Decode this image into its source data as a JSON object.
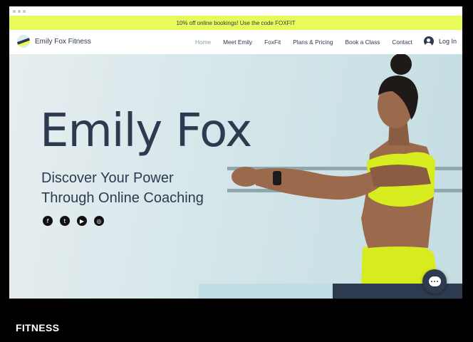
{
  "promo": {
    "text": "10% off online bookings! Use the code FOXFIT"
  },
  "brand": {
    "name": "Emily Fox Fitness"
  },
  "menu": {
    "items": [
      {
        "label": "Home",
        "active": true
      },
      {
        "label": "Meet Emily"
      },
      {
        "label": "FoxFit"
      },
      {
        "label": "Plans & Pricing"
      },
      {
        "label": "Book a Class"
      },
      {
        "label": "Contact"
      }
    ],
    "login_label": "Log In"
  },
  "hero": {
    "title": "Emily Fox",
    "subtitle_line1": "Discover Your Power",
    "subtitle_line2": "Through Online Coaching",
    "socials": [
      {
        "icon": "facebook-icon",
        "glyph": "f"
      },
      {
        "icon": "twitter-icon",
        "glyph": "t"
      },
      {
        "icon": "youtube-icon",
        "glyph": "▶"
      },
      {
        "icon": "instagram-icon",
        "glyph": "◎"
      }
    ]
  },
  "caption": {
    "text": "FITNESS"
  },
  "colors": {
    "accent": "#e9fb5a",
    "navy": "#2d3a4f",
    "hero_bg": "#c3dde2"
  }
}
